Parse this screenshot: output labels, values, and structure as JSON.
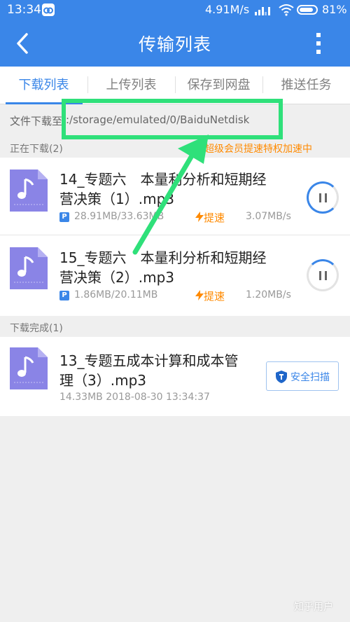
{
  "status_bar": {
    "time": "13:34",
    "network_speed": "4.91M/s",
    "battery_percent": "81%"
  },
  "app_bar": {
    "title": "传输列表"
  },
  "tabs": [
    {
      "label": "下载列表",
      "active": true
    },
    {
      "label": "上传列表",
      "active": false
    },
    {
      "label": "保存到网盘",
      "active": false
    },
    {
      "label": "推送任务",
      "active": false
    }
  ],
  "path_row": {
    "label": "文件下载至",
    "path": ":/storage/emulated/0/BaiduNetdisk"
  },
  "downloading_section": {
    "label": "正在下载(2)",
    "promo": "超级会员提速特权加速中"
  },
  "downloading_items": [
    {
      "name_line1": "14_专题六　本量利分析和短期经",
      "name_line2": "营决策（1）.mp3",
      "badge": "P",
      "size": "28.91MB/33.63MB",
      "boost_label": "提速",
      "speed": "3.07MB/s",
      "progress": 0.86
    },
    {
      "name_line1": "15_专题六　本量利分析和短期经",
      "name_line2": "营决策（2）.mp3",
      "badge": "P",
      "size": "1.86MB/20.11MB",
      "boost_label": "提速",
      "speed": "1.20MB/s",
      "progress": 0.09
    }
  ],
  "completed_section": {
    "label": "下载完成(1)"
  },
  "completed_items": [
    {
      "name_line1": "13_专题五成本计算和成本管",
      "name_line2": "理（3）.mp3",
      "info": "14.33MB 2018-08-30 13:34:37",
      "scan_label": "安全扫描"
    }
  ],
  "watermark": "知乎用户",
  "colors": {
    "brand_blue": "#3a86e8",
    "boost_orange": "#ff8a00",
    "annotation_green": "#2fe07a",
    "file_icon_purple": "#8a84e6"
  },
  "icons": [
    "back-arrow-icon",
    "more-vertical-icon",
    "music-file-icon",
    "pause-icon",
    "lightning-icon",
    "shield-icon",
    "wifi-icon",
    "signal-icon",
    "battery-icon"
  ]
}
